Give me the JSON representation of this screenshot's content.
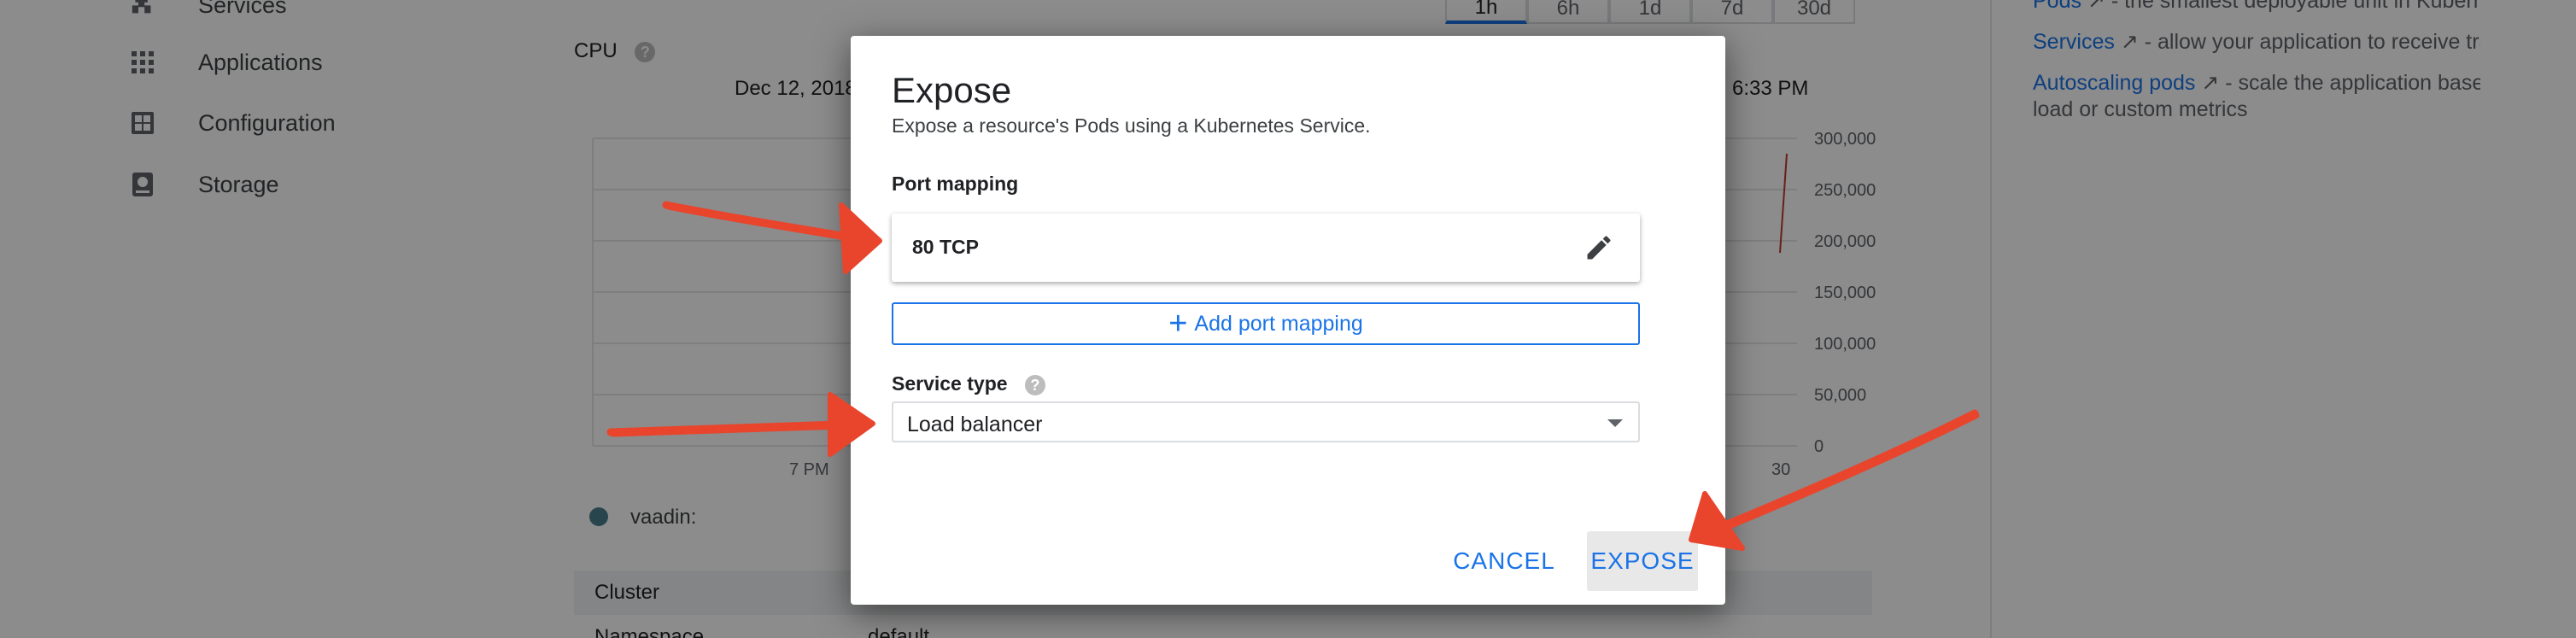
{
  "sidebar": {
    "items": [
      {
        "label": "Services",
        "icon": "services-icon"
      },
      {
        "label": "Applications",
        "icon": "applications-grid-icon"
      },
      {
        "label": "Configuration",
        "icon": "configuration-icon"
      },
      {
        "label": "Storage",
        "icon": "storage-icon"
      }
    ]
  },
  "main": {
    "time_range_buttons": [
      "1h",
      "6h",
      "1d",
      "7d",
      "30d"
    ],
    "active_range": "1h",
    "chart_title": "CPU",
    "range_start": "Dec 12, 2018",
    "range_end": "6:33 PM",
    "legend_label": "vaadin:",
    "details": [
      {
        "key": "Cluster",
        "value": ""
      },
      {
        "key": "Namespace",
        "value": "default"
      }
    ]
  },
  "chart_data": {
    "type": "line",
    "title": "CPU",
    "x_tick_labels": [
      "7 PM",
      "30"
    ],
    "y_tick_labels": [
      "300,000",
      "250,000",
      "200,000",
      "150,000",
      "100,000",
      "50,000",
      "0"
    ],
    "ylim": [
      0,
      300000
    ],
    "series": [
      {
        "name": "vaadin:",
        "values": []
      }
    ],
    "grid": true
  },
  "right_panel": {
    "lines": [
      {
        "link": "Pods",
        "text": " - the smallest deployable unit in Kubernetes"
      },
      {
        "link": "Services",
        "text": " - allow your application to receive traffic"
      },
      {
        "link": "Autoscaling pods",
        "text": " - scale the application based on"
      },
      {
        "link": "",
        "text": "load or custom metrics"
      }
    ]
  },
  "dialog": {
    "title": "Expose",
    "subtitle": "Expose a resource's Pods using a Kubernetes Service.",
    "port_mapping_label": "Port mapping",
    "port_value": "80 TCP",
    "add_port_label": "Add port mapping",
    "service_type_label": "Service type",
    "service_type_value": "Load balancer",
    "cancel_label": "CANCEL",
    "expose_label": "EXPOSE"
  },
  "colors": {
    "accent": "#1a73e8",
    "overlay": "rgba(0,0,0,0.45)",
    "annotation_arrow": "#e8452c",
    "legend_dot": "#4a7f8c"
  }
}
